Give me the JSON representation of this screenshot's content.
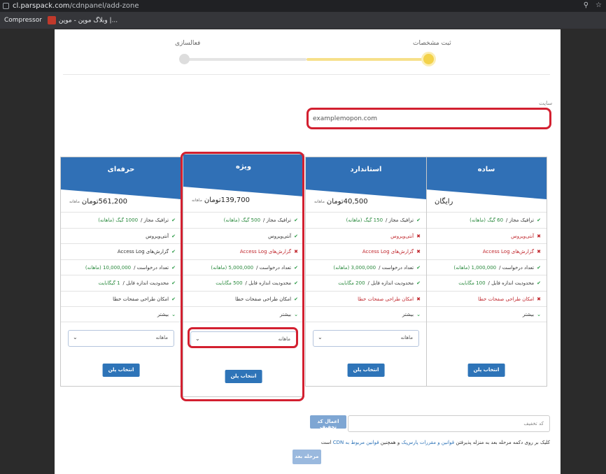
{
  "browser": {
    "url_host": "cl.parspack.com",
    "url_path": "/cdnpanel/add-zone",
    "bookmarks": [
      {
        "label": "Compressor"
      },
      {
        "label": "وبلاگ موپن - موپن |..."
      }
    ]
  },
  "stepper": {
    "step_current": "ثبت مشخصات",
    "step_next": "فعالسازی",
    "accent_color": "#f6e08a"
  },
  "site": {
    "label": "سایت",
    "value": "examplemopon.com"
  },
  "plans": [
    {
      "title": "ساده",
      "price_text": "رایگان",
      "price_unit": "",
      "features": [
        {
          "icon": "check-icon",
          "text": "ترافیک مجاز / ",
          "value": "60 گیگ (ماهانه)",
          "status": "ok"
        },
        {
          "icon": "cross-icon",
          "text": "آنتی‌ویروس",
          "value": "",
          "status": "no"
        },
        {
          "icon": "cross-icon",
          "text": "گزارش‌های Access Log",
          "value": "",
          "status": "no"
        },
        {
          "icon": "check-icon",
          "text": "تعداد درخواست / ",
          "value": "1,000,000 (ماهانه)",
          "status": "ok"
        },
        {
          "icon": "check-icon",
          "text": "محدودیت اندازه فایل / ",
          "value": "100 مگابایت",
          "status": "ok"
        },
        {
          "icon": "cross-icon",
          "text": "امکان طراحی صفحات خطا",
          "value": "",
          "status": "no"
        },
        {
          "icon": "chevron-icon",
          "text": "بیشتر",
          "value": "",
          "status": "more"
        }
      ],
      "period": "",
      "choose_label": "انتخاب پلن"
    },
    {
      "title": "استاندارد",
      "price_text": "40,500",
      "price_unit": "تومان",
      "price_unit_small": "ماهانه",
      "features": [
        {
          "icon": "check-icon",
          "text": "ترافیک مجاز / ",
          "value": "150 گیگ (ماهانه)",
          "status": "ok"
        },
        {
          "icon": "cross-icon",
          "text": "آنتی‌ویروس",
          "value": "",
          "status": "no"
        },
        {
          "icon": "cross-icon",
          "text": "گزارش‌های Access Log",
          "value": "",
          "status": "no"
        },
        {
          "icon": "check-icon",
          "text": "تعداد درخواست / ",
          "value": "3,000,000 (ماهانه)",
          "status": "ok"
        },
        {
          "icon": "check-icon",
          "text": "محدودیت اندازه فایل / ",
          "value": "200 مگابایت",
          "status": "ok"
        },
        {
          "icon": "cross-icon",
          "text": "امکان طراحی صفحات خطا",
          "value": "",
          "status": "no"
        },
        {
          "icon": "chevron-icon",
          "text": "بیشتر",
          "value": "",
          "status": "more"
        }
      ],
      "period": "ماهانه",
      "choose_label": "انتخاب پلن"
    },
    {
      "title": "ویژه",
      "price_text": "139,700",
      "price_unit": "تومان",
      "price_unit_small": "ماهانه",
      "features": [
        {
          "icon": "check-icon",
          "text": "ترافیک مجاز / ",
          "value": "500 گیگ (ماهانه)",
          "status": "ok"
        },
        {
          "icon": "check-icon",
          "text": "آنتی‌ویروس",
          "value": "",
          "status": "ok"
        },
        {
          "icon": "cross-icon",
          "text": "گزارش‌های Access Log",
          "value": "",
          "status": "no"
        },
        {
          "icon": "check-icon",
          "text": "تعداد درخواست / ",
          "value": "5,000,000 (ماهانه)",
          "status": "ok"
        },
        {
          "icon": "check-icon",
          "text": "محدودیت اندازه فایل / ",
          "value": "500 مگابایت",
          "status": "ok"
        },
        {
          "icon": "check-icon",
          "text": "امکان طراحی صفحات خطا",
          "value": "",
          "status": "ok"
        },
        {
          "icon": "chevron-icon",
          "text": "بیشتر",
          "value": "",
          "status": "more"
        }
      ],
      "period": "ماهانه",
      "choose_label": "انتخاب پلن"
    },
    {
      "title": "حرفه‌ای",
      "price_text": "561,200",
      "price_unit": "تومان",
      "price_unit_small": "ماهانه",
      "features": [
        {
          "icon": "check-icon",
          "text": "ترافیک مجاز / ",
          "value": "1000 گیگ (ماهانه)",
          "status": "ok"
        },
        {
          "icon": "check-icon",
          "text": "آنتی‌ویروس",
          "value": "",
          "status": "ok"
        },
        {
          "icon": "check-icon",
          "text": "گزارش‌های Access Log",
          "value": "",
          "status": "ok"
        },
        {
          "icon": "check-icon",
          "text": "تعداد درخواست / ",
          "value": "10,000,000 (ماهانه)",
          "status": "ok"
        },
        {
          "icon": "check-icon",
          "text": "محدودیت اندازه فایل / ",
          "value": "1 گیگابایت",
          "status": "ok"
        },
        {
          "icon": "check-icon",
          "text": "امکان طراحی صفحات خطا",
          "value": "",
          "status": "ok"
        },
        {
          "icon": "chevron-icon",
          "text": "بیشتر",
          "value": "",
          "status": "more"
        }
      ],
      "period": "ماهانه",
      "choose_label": "انتخاب پلن"
    }
  ],
  "discount": {
    "placeholder": "کد تخفیف",
    "apply_label": "اعمال کد تخفیف"
  },
  "terms": {
    "prefix": "کلیک بر روی دکمه مرحله بعد به منزله پذیرفتن ",
    "link1": "قوانین و مقررات پارس‌پک",
    "middle": " و همچنین ",
    "link2": "قوانین مربوط به CDN",
    "suffix": " است"
  },
  "next_label": "مرحله بعد"
}
